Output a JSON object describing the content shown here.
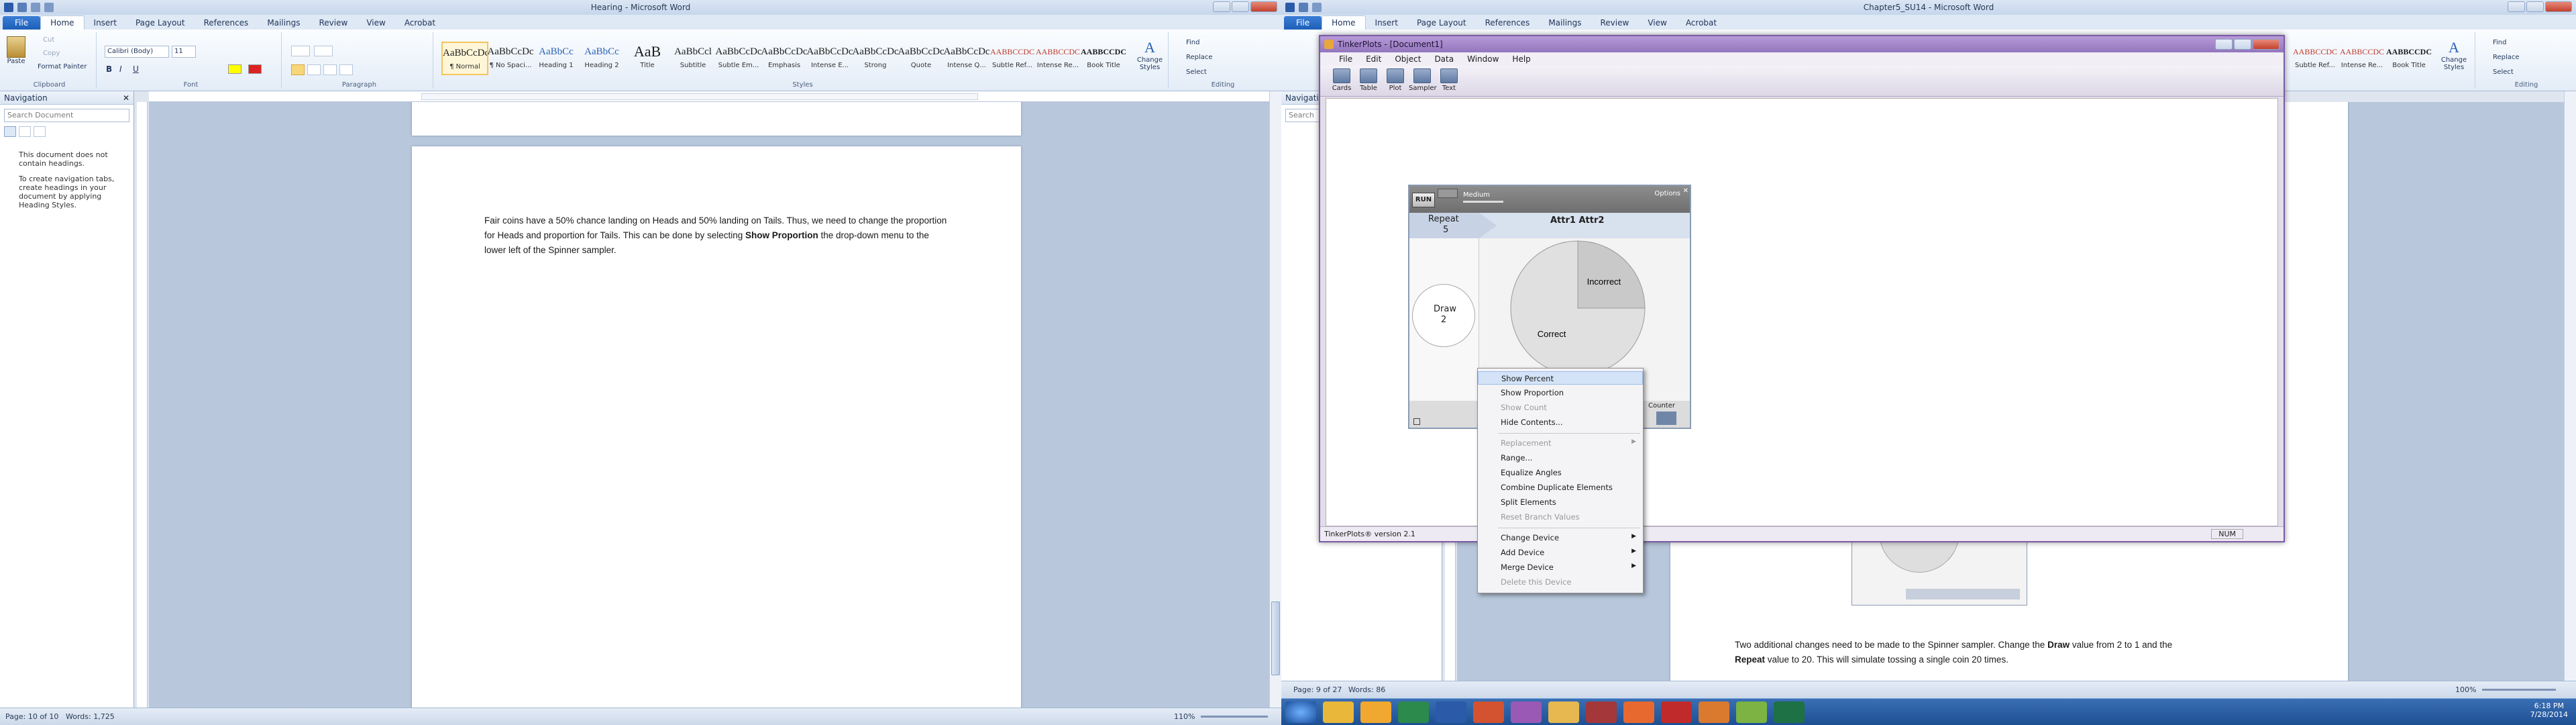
{
  "left_window": {
    "title": "Hearing - Microsoft Word",
    "tabs": [
      "File",
      "Home",
      "Insert",
      "Page Layout",
      "References",
      "Mailings",
      "Review",
      "View",
      "Acrobat"
    ],
    "ribbon": {
      "clipboard": {
        "paste": "Paste",
        "cut": "Cut",
        "copy": "Copy",
        "format_painter": "Format Painter",
        "label": "Clipboard"
      },
      "font": {
        "name": "Calibri (Body)",
        "size": "11",
        "label": "Font"
      },
      "paragraph": {
        "label": "Paragraph"
      },
      "styles": {
        "label": "Styles",
        "items": [
          {
            "preview": "AaBbCcDc",
            "name": "¶ Normal"
          },
          {
            "preview": "AaBbCcDc",
            "name": "¶ No Spaci..."
          },
          {
            "preview": "AaBbCc",
            "name": "Heading 1"
          },
          {
            "preview": "AaBbCc",
            "name": "Heading 2"
          },
          {
            "preview": "AaB",
            "name": "Title"
          },
          {
            "preview": "AaBbCcl",
            "name": "Subtitle"
          },
          {
            "preview": "AaBbCcDc",
            "name": "Subtle Em..."
          },
          {
            "preview": "AaBbCcDc",
            "name": "Emphasis"
          },
          {
            "preview": "AaBbCcDc",
            "name": "Intense E..."
          },
          {
            "preview": "AaBbCcDc",
            "name": "Strong"
          },
          {
            "preview": "AaBbCcDc",
            "name": "Quote"
          },
          {
            "preview": "AaBbCcDc",
            "name": "Intense Q..."
          },
          {
            "preview": "AABBCCDC",
            "name": "Subtle Ref..."
          },
          {
            "preview": "AABBCCDC",
            "name": "Intense Re..."
          },
          {
            "preview": "AABBCCDC",
            "name": "Book Title"
          }
        ],
        "change_styles": "Change Styles"
      },
      "editing": {
        "find": "Find",
        "replace": "Replace",
        "select": "Select",
        "label": "Editing"
      }
    },
    "navigation": {
      "title": "Navigation",
      "search_placeholder": "Search Document",
      "message": "This document does not contain headings.",
      "hint": "To create navigation tabs, create headings in your document by applying Heading Styles."
    },
    "document": {
      "paragraph_before": "Fair coins have a 50% chance landing on Heads and 50% landing on Tails.  Thus, we need to change the proportion for Heads and proportion for Tails.  This can be done by selecting ",
      "paragraph_bold": "Show Proportion",
      "paragraph_after": " the drop-down menu to the lower left of the Spinner sampler."
    },
    "status": {
      "page": "Page: 10 of 10",
      "words": "Words: 1,725",
      "zoom": "110%"
    }
  },
  "right_window": {
    "title": "Chapter5_SU14 - Microsoft Word",
    "tabs": [
      "File",
      "Home",
      "Insert",
      "Page Layout",
      "References",
      "Mailings",
      "Review",
      "View",
      "Acrobat"
    ],
    "styles": [
      {
        "preview": "AABBCCDC",
        "name": "Subtle Ref..."
      },
      {
        "preview": "AABBCCDC",
        "name": "Intense Re..."
      },
      {
        "preview": "AABBCCDC",
        "name": "Book Title"
      }
    ],
    "change_styles": "Change Styles",
    "editing": {
      "find": "Find",
      "replace": "Replace",
      "select": "Select",
      "label": "Editing"
    },
    "nav_title": "Navigation",
    "nav_search": "Search",
    "document": {
      "text_1": "Two additional changes need to be made to the Spinner sampler.  Change the ",
      "bold_1": "Draw",
      "text_2": " value from 2 to 1 and the ",
      "bold_2": "Repeat",
      "text_3": " value to 20.  This will simulate tossing a single coin 20 times."
    },
    "status": {
      "page": "Page: 9 of 27",
      "words": "Words: 86",
      "zoom": "100%"
    }
  },
  "tinkerplots": {
    "title": "TinkerPlots - [Document1]",
    "menu": [
      "File",
      "Edit",
      "Object",
      "Data",
      "Window",
      "Help"
    ],
    "tools": [
      "Cards",
      "Table",
      "Plot",
      "Sampler",
      "Text"
    ],
    "status": "TinkerPlots® version 2.1",
    "num": "NUM",
    "sampler": {
      "run": "RUN",
      "speed": "Medium",
      "options": "Options",
      "repeat_label": "Repeat",
      "repeat_value": "5",
      "attr_title": "Attr1 Attr2",
      "draw_label": "Draw",
      "draw_value": "2",
      "slices": [
        {
          "label": "Incorrect",
          "proportion": 0.25
        },
        {
          "label": "Correct",
          "proportion": 0.75
        }
      ],
      "counter": "Counter"
    },
    "context_menu": {
      "items": [
        {
          "label": "Show Percent",
          "enabled": true,
          "arrow": false
        },
        {
          "label": "Show Proportion",
          "enabled": true,
          "arrow": false
        },
        {
          "label": "Show Count",
          "enabled": false,
          "arrow": false
        },
        {
          "label": "Hide Contents...",
          "enabled": true,
          "arrow": false
        },
        {
          "label": "Replacement",
          "enabled": false,
          "arrow": true
        },
        {
          "label": "Range...",
          "enabled": true,
          "arrow": false
        },
        {
          "label": "Equalize Angles",
          "enabled": true,
          "arrow": false
        },
        {
          "label": "Combine Duplicate Elements",
          "enabled": true,
          "arrow": false
        },
        {
          "label": "Split Elements",
          "enabled": true,
          "arrow": false
        },
        {
          "label": "Reset Branch Values",
          "enabled": false,
          "arrow": false
        },
        {
          "label": "Change Device",
          "enabled": true,
          "arrow": true
        },
        {
          "label": "Add Device",
          "enabled": true,
          "arrow": true
        },
        {
          "label": "Merge Device",
          "enabled": true,
          "arrow": true
        },
        {
          "label": "Delete this Device",
          "enabled": false,
          "arrow": false
        }
      ]
    }
  },
  "taskbar": {
    "time": "6:18 PM",
    "date": "7/28/2014",
    "apps": [
      "Start",
      "Chrome",
      "Outlook",
      "Excel",
      "Word",
      "PowerPoint",
      "TinkerPlots",
      "Explorer",
      "Access",
      "Firefox",
      "Acrobat",
      "Tinker",
      "Stats",
      "Excel2"
    ]
  },
  "colors": {
    "word_blue": "#1d5fb8",
    "tinkerplots_purple": "#9376bd",
    "taskbar": "#1d4f93"
  }
}
